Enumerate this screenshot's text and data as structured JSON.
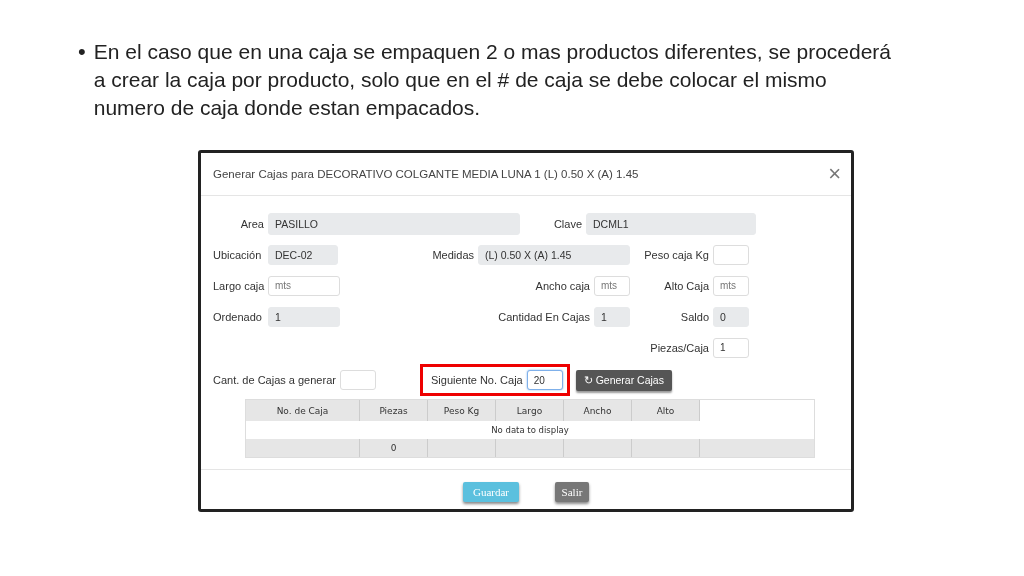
{
  "slide": {
    "bullet": "•",
    "text": "En el caso que en una caja se empaquen 2 o mas productos diferentes, se procederá a crear la caja por producto, solo que en el # de caja se debe colocar el mismo numero de caja donde estan empacados."
  },
  "dialog": {
    "title": "Generar Cajas para DECORATIVO COLGANTE MEDIA LUNA 1 (L) 0.50 X (A) 1.45",
    "close": "×"
  },
  "fields": [
    {
      "label": "Area",
      "kind": "readonly",
      "value": "PASILLO"
    },
    {
      "label": "Clave",
      "kind": "readonly",
      "value": "DCML1"
    },
    {
      "label": "Ubicación",
      "kind": "readonly",
      "value": "DEC-02"
    },
    {
      "label": "Medidas",
      "kind": "readonly",
      "value": "(L) 0.50 X (A) 1.45"
    },
    {
      "label": "Peso caja Kg",
      "kind": "input"
    },
    {
      "label": "Largo caja",
      "kind": "input",
      "placeholder": "mts"
    },
    {
      "label": "Ancho caja",
      "kind": "input",
      "placeholder": "mts"
    },
    {
      "label": "Alto Caja",
      "kind": "input",
      "placeholder": "mts"
    },
    {
      "label": "Ordenado",
      "kind": "readonly",
      "value": "1"
    },
    {
      "label": "Cantidad En Cajas",
      "kind": "readonly",
      "value": "1"
    },
    {
      "label": "Saldo",
      "kind": "readonly",
      "value": "0"
    },
    {
      "label": "Piezas/Caja",
      "kind": "input",
      "value": "1"
    },
    {
      "label": "Cant. de Cajas a generar",
      "kind": "input"
    },
    {
      "label": "Siguiente No. Caja",
      "kind": "input",
      "value": "20",
      "focused": true,
      "highlighted": true
    }
  ],
  "generate_button": {
    "icon": "↻",
    "label": "Generar Cajas"
  },
  "table": {
    "columns": [
      "No. de Caja",
      "Piezas",
      "Peso Kg",
      "Largo",
      "Ancho",
      "Alto"
    ],
    "empty_message": "No data to display",
    "footer": {
      "piezas_total": "0"
    }
  },
  "buttons": [
    {
      "label": "Guardar",
      "kind": "primary"
    },
    {
      "label": "Salir",
      "kind": "secondary"
    }
  ]
}
